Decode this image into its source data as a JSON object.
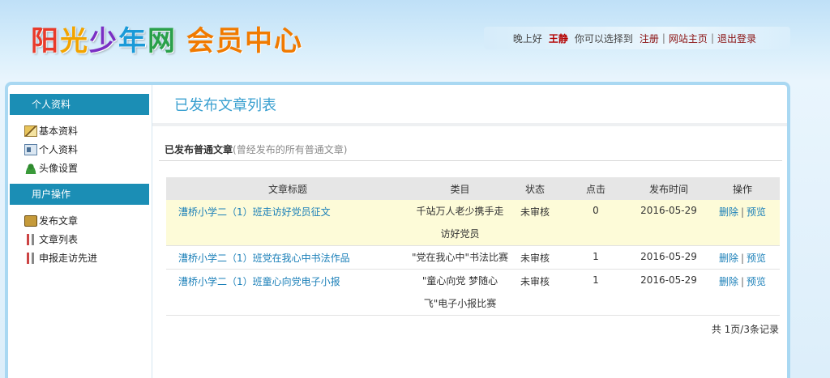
{
  "logo": {
    "chars": [
      "阳",
      "光",
      "少",
      "年",
      "网"
    ],
    "colors": [
      "#e83a2a",
      "#f2a400",
      "#7a2fc4",
      "#1a9ad8",
      "#2aa04a"
    ],
    "sub": "会员中心"
  },
  "topbar": {
    "greeting": "晚上好",
    "username": "王静",
    "choose_text": "你可以选择到",
    "links": [
      "注册",
      "网站主页",
      "退出登录"
    ]
  },
  "sidebar": {
    "sections": [
      {
        "title": "个人资料",
        "items": [
          {
            "label": "基本资料",
            "icon": "pencil-icon"
          },
          {
            "label": "个人资料",
            "icon": "id-card-icon"
          },
          {
            "label": "头像设置",
            "icon": "avatar-icon"
          }
        ]
      },
      {
        "title": "用户操作",
        "items": [
          {
            "label": "发布文章",
            "icon": "bag-icon"
          },
          {
            "label": "文章列表",
            "icon": "tools-icon"
          },
          {
            "label": "申报走访先进",
            "icon": "tools-icon"
          }
        ]
      }
    ]
  },
  "main": {
    "page_title": "已发布文章列表",
    "section_title": "已发布普通文章",
    "section_note": "(曾经发布的所有普通文章)",
    "table": {
      "headers": [
        "文章标题",
        "类目",
        "状态",
        "点击",
        "发布时间",
        "操作"
      ],
      "rows": [
        {
          "title": "漕桥小学二（1）班走访好党员征文",
          "cat1": "千站万人老少携手走",
          "cat2": "访好党员",
          "status": "未审核",
          "clicks": "0",
          "date": "2016-05-29",
          "op_delete": "删除",
          "op_preview": "预览",
          "highlight": true
        },
        {
          "title": "漕桥小学二（1）班党在我心中书法作品",
          "cat1": "\"党在我心中\"书法比赛",
          "cat2": "",
          "status": "未审核",
          "clicks": "1",
          "date": "2016-05-29",
          "op_delete": "删除",
          "op_preview": "预览",
          "highlight": false
        },
        {
          "title": "漕桥小学二（1）班童心向党电子小报",
          "cat1": "\"童心向党 梦随心",
          "cat2": "飞\"电子小报比赛",
          "status": "未审核",
          "clicks": "1",
          "date": "2016-05-29",
          "op_delete": "删除",
          "op_preview": "预览",
          "highlight": false
        }
      ]
    },
    "pager": "共 1页/3条记录"
  }
}
